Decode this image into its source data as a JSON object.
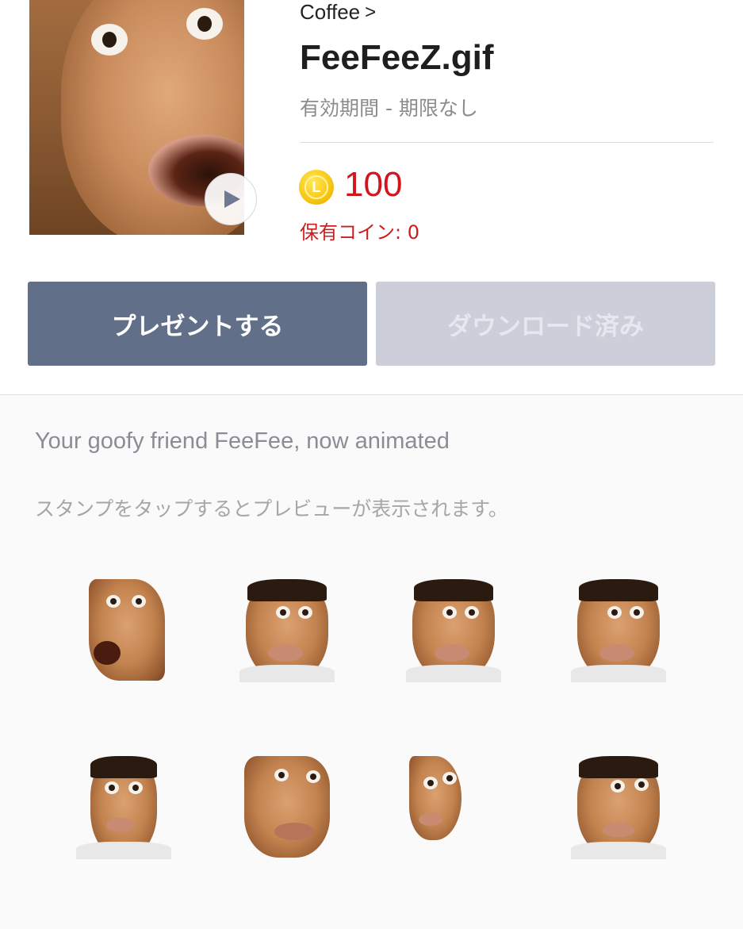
{
  "product": {
    "author": "Coffee",
    "author_chevron": ">",
    "title": "FeeFeeZ.gif",
    "validity": "有効期間 - 期限なし",
    "coin_symbol": "L",
    "price": "100",
    "owned_coins": "保有コイン: 0"
  },
  "buttons": {
    "gift_label": "プレゼントする",
    "download_label": "ダウンロード済み"
  },
  "description": "Your goofy friend FeeFee, now animated",
  "preview_hint": "スタンプをタップするとプレビューが表示されます。",
  "stickers": [
    "sticker-1",
    "sticker-2",
    "sticker-3",
    "sticker-4",
    "sticker-5",
    "sticker-6",
    "sticker-7",
    "sticker-8"
  ],
  "colors": {
    "gift_button": "#626f89",
    "download_button": "#cccfda",
    "price": "#d2141d",
    "coin": "#f8c915"
  }
}
